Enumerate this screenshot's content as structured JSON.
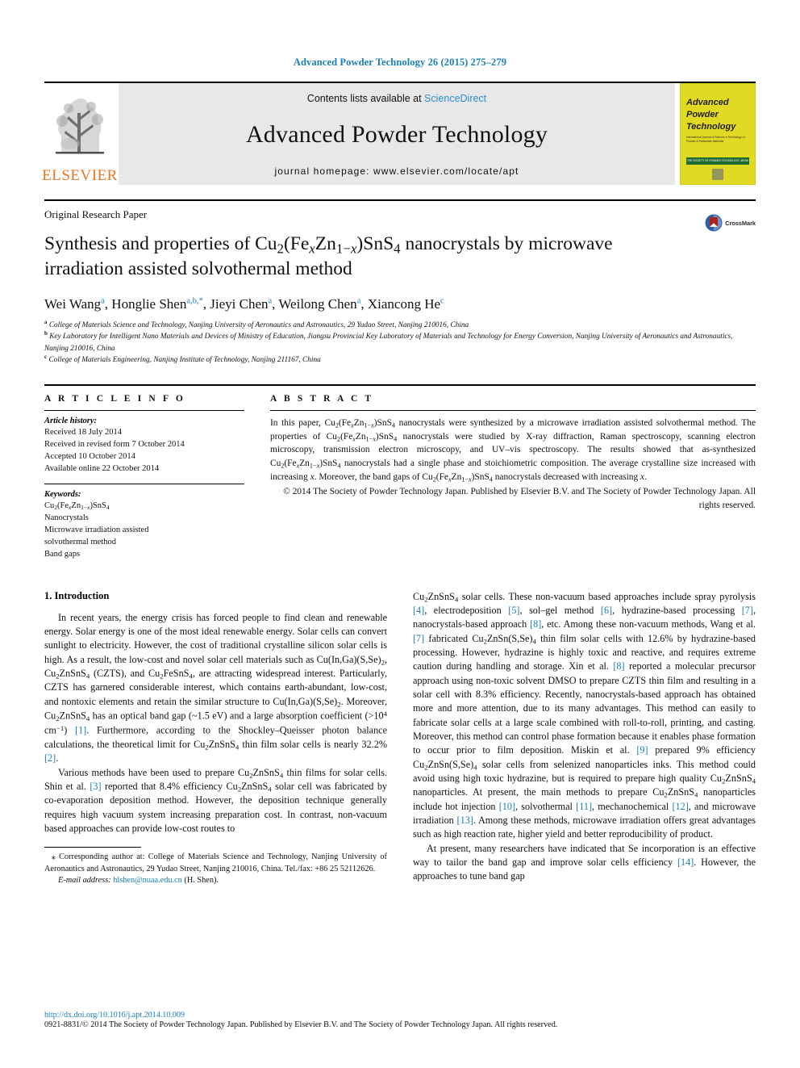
{
  "running_head": "Advanced Powder Technology 26 (2015) 275–279",
  "masthead": {
    "publisher_name": "ELSEVIER",
    "contents_prefix": "Contents lists available at ",
    "contents_link": "ScienceDirect",
    "journal_name": "Advanced Powder Technology",
    "homepage": "journal homepage: www.elsevier.com/locate/apt",
    "cover": {
      "line1": "Advanced",
      "line2": "Powder",
      "line3": "Technology",
      "subtitle": "International Journal of Science & Technology of Powder & Particulate Materials",
      "band_text": "THE SOCIETY OF POWDER TECHNOLOGY JAPAN"
    }
  },
  "article": {
    "type": "Original Research Paper",
    "title_line1_pre": "Synthesis and properties of Cu",
    "title_formula": "2(FexZn1−x)SnS4",
    "title_line1_post": " nanocrystals by",
    "title_line2": "microwave irradiation assisted solvothermal method",
    "crossmark_label": "CrossMark"
  },
  "authors": [
    {
      "name": "Wei Wang",
      "marks": "a",
      "sep": ", "
    },
    {
      "name": "Honglie Shen",
      "marks": "a,b,*",
      "sep": ", "
    },
    {
      "name": "Jieyi Chen",
      "marks": "a",
      "sep": ", "
    },
    {
      "name": "Weilong Chen",
      "marks": "a",
      "sep": ", "
    },
    {
      "name": "Xiancong He",
      "marks": "c",
      "sep": ""
    }
  ],
  "affiliations": [
    {
      "mark": "a",
      "text": "College of Materials Science and Technology, Nanjing University of Aeronautics and Astronautics, 29 Yudao Street, Nanjing 210016, China"
    },
    {
      "mark": "b",
      "text": "Key Laboratory for Intelligent Nano Materials and Devices of Ministry of Education, Jiangsu Provincial Key Laboratory of Materials and Technology for Energy Conversion, Nanjing University of Aeronautics and Astronautics, Nanjing 210016, China"
    },
    {
      "mark": "c",
      "text": "College of Materials Engineering, Nanjing Institute of Technology, Nanjing 211167, China"
    }
  ],
  "article_info": {
    "heading": "A R T I C L E  I N F O",
    "history_label": "Article history:",
    "history": [
      "Received 18 July 2014",
      "Received in revised form 7 October 2014",
      "Accepted 10 October 2014",
      "Available online 22 October 2014"
    ],
    "keywords_label": "Keywords:",
    "keywords": [
      "Cu2(FexZn1−x)SnS4",
      "Nanocrystals",
      "Microwave irradiation assisted",
      "solvothermal method",
      "Band gaps"
    ]
  },
  "abstract": {
    "heading": "A B S T R A C T",
    "body": "In this paper, Cu2(FexZn1−x)SnS4 nanocrystals were synthesized by a microwave irradiation assisted solvothermal method. The properties of Cu2(FexZn1−x)SnS4 nanocrystals were studied by X-ray diffraction, Raman spectroscopy, scanning electron microscopy, transmission electron microscopy, and UV–vis spectroscopy. The results showed that as-synthesized Cu2(FexZn1−x)SnS4 nanocrystals had a single phase and stoichiometric composition. The average crystalline size increased with increasing x. Moreover, the band gaps of Cu2(FexZn1−x)SnS4 nanocrystals decreased with increasing x.",
    "copyright": "© 2014 The Society of Powder Technology Japan. Published by Elsevier B.V. and The Society of Powder Technology Japan. All rights reserved."
  },
  "body": {
    "section_title": "1. Introduction",
    "left_paragraph_1": "In recent years, the energy crisis has forced people to find clean and renewable energy. Solar energy is one of the most ideal renewable energy. Solar cells can convert sunlight to electricity. However, the cost of traditional crystalline silicon solar cells is high. As a result, the low-cost and novel solar cell materials such as Cu(In,Ga)(S,Se)2, Cu2ZnSnS4 (CZTS), and Cu2FeSnS4, are attracting widespread interest. Particularly, CZTS has garnered considerable interest, which contains earth-abundant, low-cost, and nontoxic elements and retain the similar structure to Cu(In,Ga)(S,Se)2. Moreover, Cu2ZnSnS4 has an optical band gap (~1.5 eV) and a large absorption coefficient (>10^4 cm−1) [1]. Furthermore, according to the Shockley–Queisser photon balance calculations, the theoretical limit for Cu2ZnSnS4 thin film solar cells is nearly 32.2% [2].",
    "left_paragraph_2": "Various methods have been used to prepare Cu2ZnSnS4 thin films for solar cells. Shin et al. [3] reported that 8.4% efficiency Cu2ZnSnS4 solar cell was fabricated by co-evaporation deposition method. However, the deposition technique generally requires high vacuum system increasing preparation cost. In contrast, non-vacuum based approaches can provide low-cost routes to",
    "right_paragraph_1": "Cu2ZnSnS4 solar cells. These non-vacuum based approaches include spray pyrolysis [4], electrodeposition [5], sol–gel method [6], hydrazine-based processing [7], nanocrystals-based approach [8], etc. Among these non-vacuum methods, Wang et al. [7] fabricated Cu2ZnSn(S,Se)4 thin film solar cells with 12.6% by hydrazine-based processing. However, hydrazine is highly toxic and reactive, and requires extreme caution during handling and storage. Xin et al. [8] reported a molecular precursor approach using non-toxic solvent DMSO to prepare CZTS thin film and resulting in a solar cell with 8.3% efficiency. Recently, nanocrystals-based approach has obtained more and more attention, due to its many advantages. This method can easily to fabricate solar cells at a large scale combined with roll-to-roll, printing, and casting. Moreover, this method can control phase formation because it enables phase formation to occur prior to film deposition. Miskin et al. [9] prepared 9% efficiency Cu2ZnSn(S,Se)4 solar cells from selenized nanoparticles inks. This method could avoid using high toxic hydrazine, but is required to prepare high quality Cu2ZnSnS4 nanoparticles. At present, the main methods to prepare Cu2ZnSnS4 nanoparticles include hot injection [10], solvothermal [11], mechanochemical [12], and microwave irradiation [13]. Among these methods, microwave irradiation offers great advantages such as high reaction rate, higher yield and better reproducibility of product.",
    "right_paragraph_2": "At present, many researchers have indicated that Se incorporation is an effective way to tailor the band gap and improve solar cells efficiency [14]. However, the approaches to tune band gap"
  },
  "footnotes": {
    "corresponding": "Corresponding author at: College of Materials Science and Technology, Nanjing University of Aeronautics and Astronautics, 29 Yudao Street, Nanjing 210016, China. Tel./fax: +86 25 52112626.",
    "email_label": "E-mail address:",
    "email": "hlshen@nuaa.edu.cn",
    "email_suffix": "(H. Shen)."
  },
  "footer": {
    "doi": "http://dx.doi.org/10.1016/j.apt.2014.10.009",
    "issn_copyright": "0921-8831/© 2014 The Society of Powder Technology Japan. Published by Elsevier B.V. and The Society of Powder Technology Japan. All rights reserved."
  },
  "colors": {
    "link": "#1a7fb5",
    "sciencedirect": "#2a8fd4",
    "elsevier_orange": "#e87722",
    "cover_yellow": "#e2d924",
    "band_gray": "#e8e8e8"
  }
}
